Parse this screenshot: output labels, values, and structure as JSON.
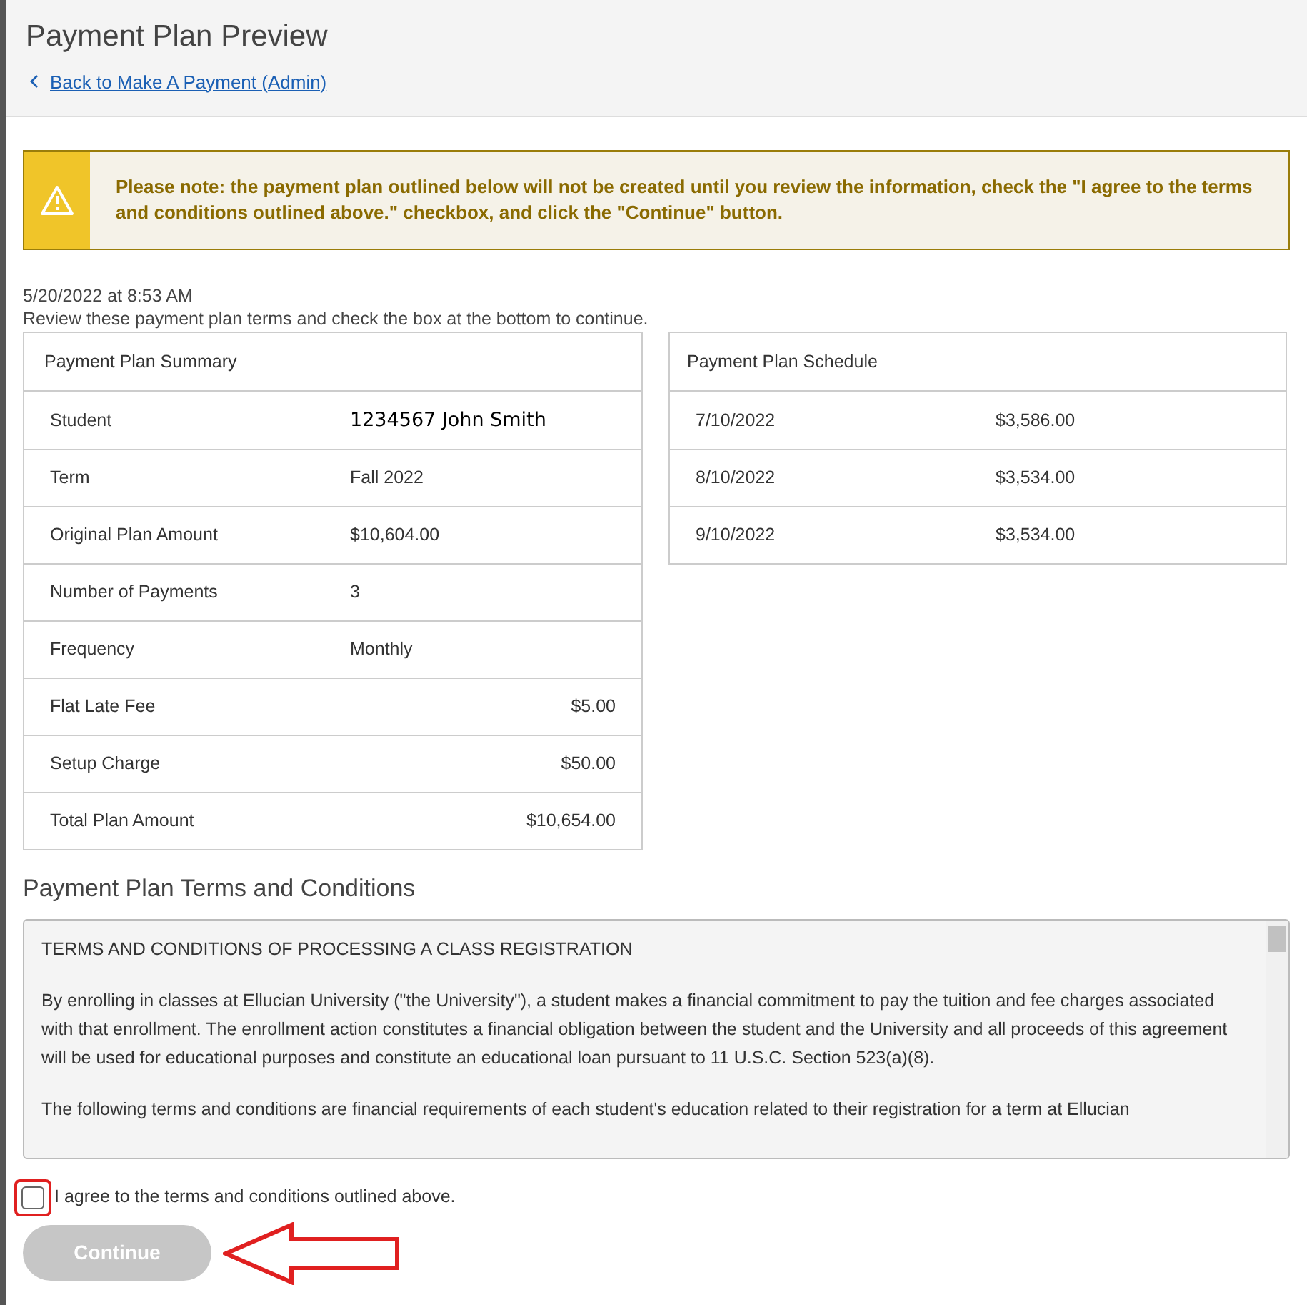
{
  "header": {
    "title": "Payment Plan Preview",
    "back_link": "Back to Make A Payment (Admin)"
  },
  "alert": {
    "text": "Please note: the payment plan outlined below will not be created until you review the information, check the \"I agree to the terms and conditions outlined above.\" checkbox, and click the \"Continue\" button."
  },
  "timestamp": "5/20/2022 at 8:53 AM",
  "instructions": "Review these payment plan terms and check the box at the bottom to continue.",
  "summary": {
    "title": "Payment Plan Summary",
    "rows": [
      {
        "label": "Student",
        "value": "1234567 John Smith",
        "kind": "name"
      },
      {
        "label": "Term",
        "value": "Fall 2022",
        "kind": "text"
      },
      {
        "label": "Original Plan Amount",
        "value": "$10,604.00",
        "kind": "text"
      },
      {
        "label": "Number of Payments",
        "value": "3",
        "kind": "text"
      },
      {
        "label": "Frequency",
        "value": "Monthly",
        "kind": "text"
      },
      {
        "label": "Flat Late Fee",
        "value": "$5.00",
        "kind": "amount"
      },
      {
        "label": "Setup Charge",
        "value": "$50.00",
        "kind": "amount"
      },
      {
        "label": "Total Plan Amount",
        "value": "$10,654.00",
        "kind": "amount"
      }
    ]
  },
  "schedule": {
    "title": "Payment Plan Schedule",
    "rows": [
      {
        "date": "7/10/2022",
        "amount": "$3,586.00"
      },
      {
        "date": "8/10/2022",
        "amount": "$3,534.00"
      },
      {
        "date": "9/10/2022",
        "amount": "$3,534.00"
      }
    ]
  },
  "terms": {
    "title": "Payment Plan Terms and Conditions",
    "paragraphs": [
      "TERMS AND CONDITIONS OF PROCESSING A CLASS REGISTRATION",
      "By enrolling in classes at Ellucian University (\"the University\"), a student makes a financial commitment to pay the tuition and fee charges associated with that enrollment. The enrollment action constitutes a financial obligation between the student and the University and all proceeds of this agreement will be used for educational purposes and constitute an educational loan pursuant to 11 U.S.C. Section 523(a)(8).",
      "The following terms and conditions are financial requirements of each student's education related to their registration for a term at Ellucian"
    ]
  },
  "agree": {
    "label": "I agree to the terms and conditions outlined above.",
    "checked": false
  },
  "continue_button": {
    "label": "Continue",
    "disabled": true
  }
}
